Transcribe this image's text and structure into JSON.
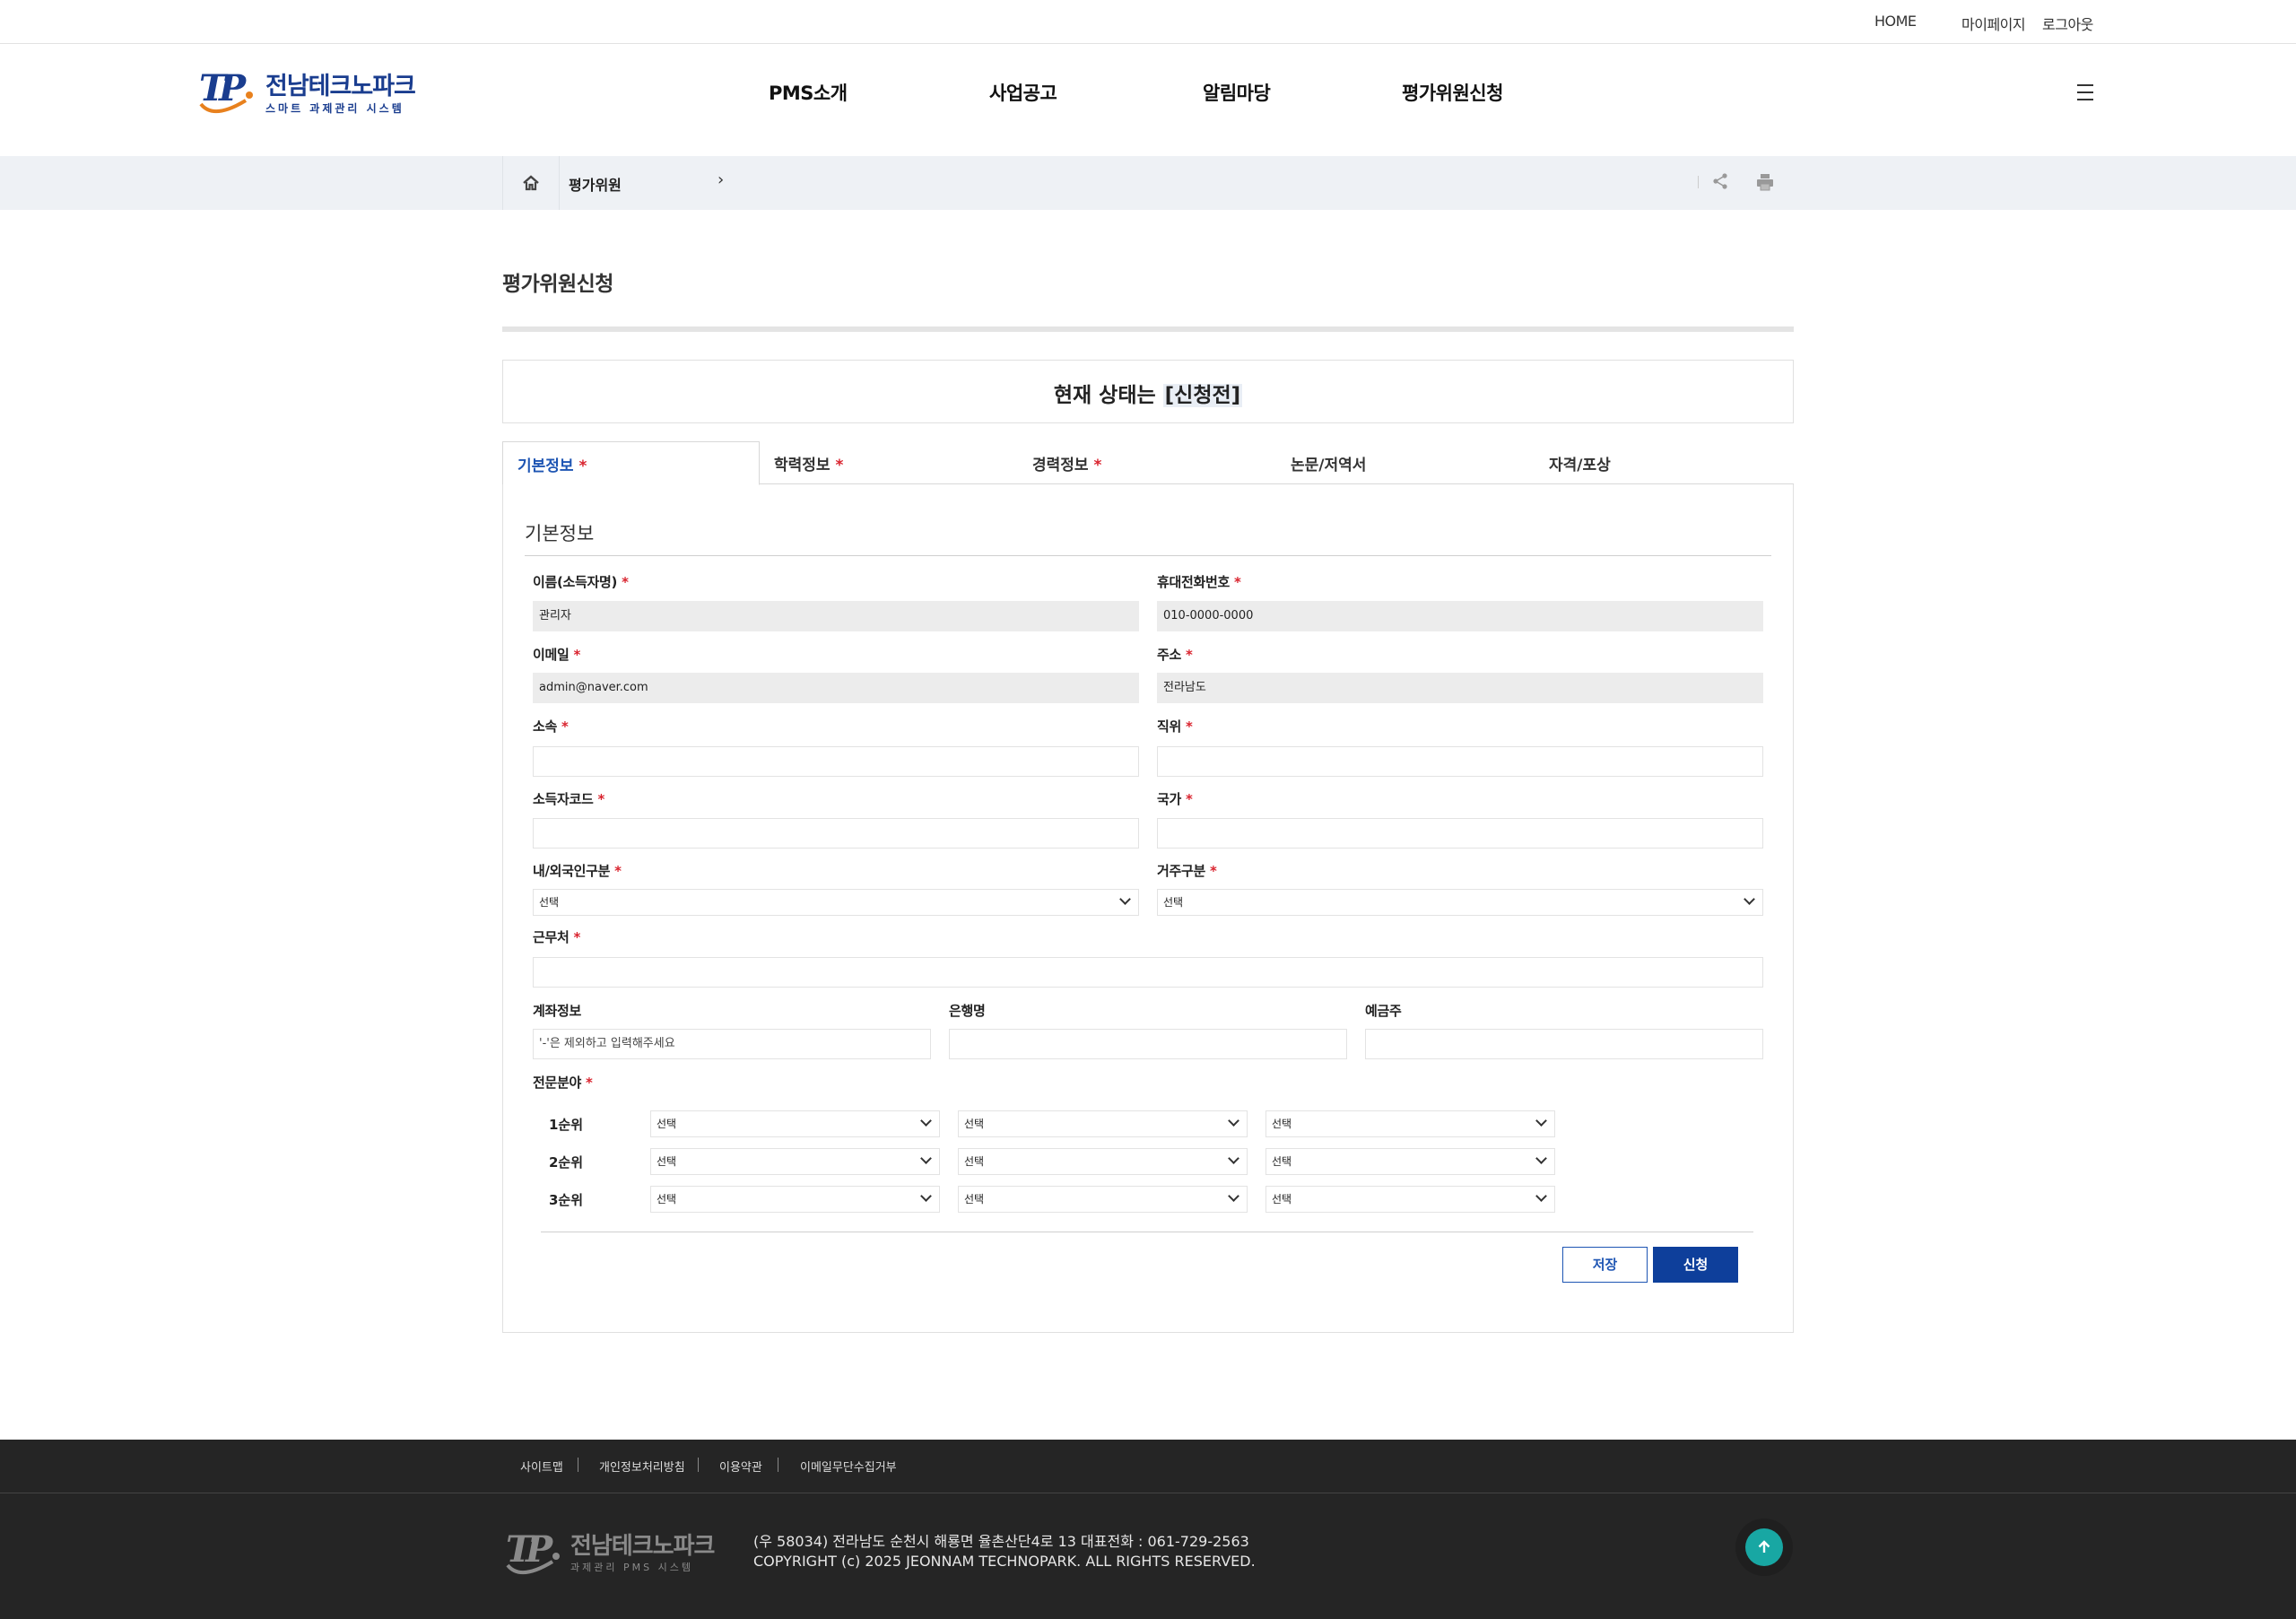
{
  "topbar": {
    "home": "HOME",
    "mypage": "마이페이지",
    "logout": "로그아웃"
  },
  "brand": {
    "title": "전남테크노파크",
    "subtitle": "스마트 과제관리 시스템",
    "footer_title": "전남테크노파크",
    "footer_subtitle": "과제관리 PMS 시스템",
    "color": "#1a3d8f",
    "accent": "#e8811e"
  },
  "nav": [
    "PMS소개",
    "사업공고",
    "알림마당",
    "평가위원신청"
  ],
  "breadcrumb": {
    "current": "평가위원",
    "arrow": "›"
  },
  "page": {
    "title": "평가위원신청"
  },
  "status": {
    "prefix": "현재 상태는 ",
    "value": "[신청전]"
  },
  "tabs": [
    {
      "label": "기본정보",
      "required": true,
      "active": true
    },
    {
      "label": "학력정보",
      "required": true
    },
    {
      "label": "경력정보",
      "required": true
    },
    {
      "label": "논문/저역서",
      "required": false
    },
    {
      "label": "자격/포상",
      "required": false
    }
  ],
  "form": {
    "section_title": "기본정보",
    "req_mark": "*",
    "name_label": "이름(소득자명)",
    "name_value": "관리자",
    "phone_label": "휴대전화번호",
    "phone_value": "010-0000-0000",
    "email_label": "이메일",
    "email_value": "admin@naver.com",
    "address_label": "주소",
    "address_value": "전라남도",
    "affiliation_label": "소속",
    "position_label": "직위",
    "income_code_label": "소득자코드",
    "country_label": "국가",
    "nationality_label": "내/외국인구분",
    "nationality_value": "선택",
    "residence_label": "거주구분",
    "residence_value": "선택",
    "workplace_label": "근무처",
    "account_label": "계좌정보",
    "account_placeholder": "'-'은 제외하고 입력해주세요",
    "bank_label": "은행명",
    "holder_label": "예금주",
    "expertise_label": "전문분야",
    "select_text": "선택",
    "ranks": [
      "1순위",
      "2순위",
      "3순위"
    ]
  },
  "buttons": {
    "save": "저장",
    "apply": "신청"
  },
  "footer": {
    "links": [
      "사이트맵",
      "개인정보처리방침",
      "이용약관",
      "이메일무단수집거부"
    ],
    "address": "(우 58034) 전라남도 순천시 해룡면 율촌산단4로 13   대표전화 : 061-729-2563",
    "copyright": "COPYRIGHT (c) 2025 JEONNAM TECHNOPARK. ALL RIGHTS RESERVED."
  },
  "icons": {
    "home": "home-icon",
    "share": "share-icon",
    "print": "print-icon",
    "menu": "hamburger-menu-icon",
    "top": "arrow-up-icon"
  }
}
